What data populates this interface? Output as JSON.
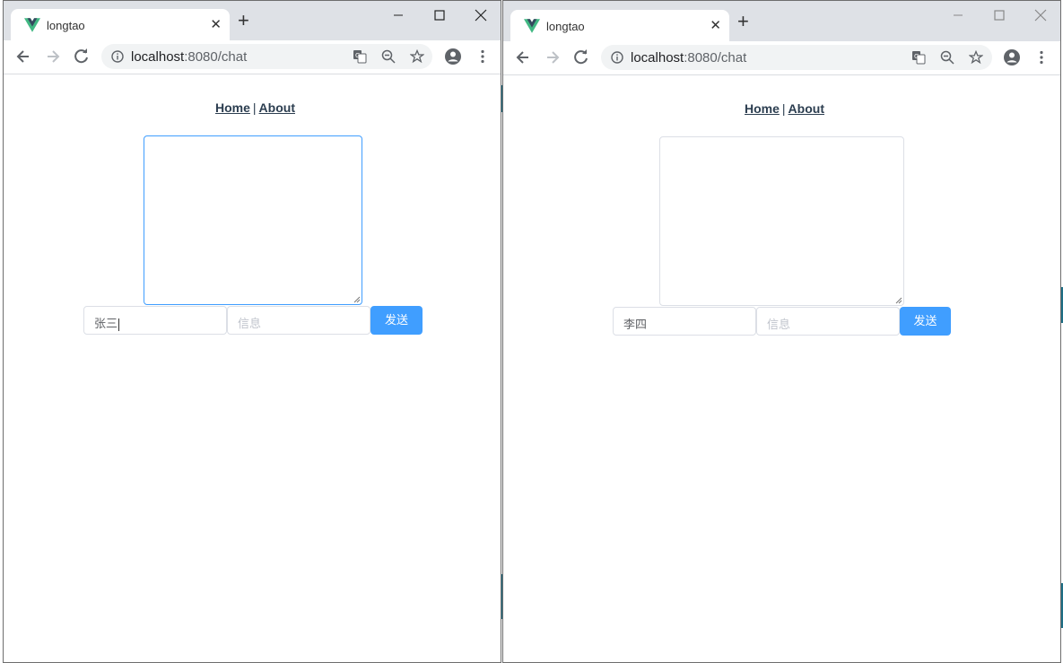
{
  "windows": [
    {
      "tab_title": "longtao",
      "url_host": "localhost",
      "url_path": ":8080/chat",
      "nav": {
        "home": "Home",
        "separator": "|",
        "about": "About"
      },
      "chat_log": "",
      "name_value": "张三",
      "message_placeholder": "信息",
      "send_label": "发送"
    },
    {
      "tab_title": "longtao",
      "url_host": "localhost",
      "url_path": ":8080/chat",
      "nav": {
        "home": "Home",
        "separator": "|",
        "about": "About"
      },
      "chat_log": "",
      "name_value": "李四",
      "message_placeholder": "信息",
      "send_label": "发送"
    }
  ],
  "colors": {
    "accent": "#409eff",
    "vue_green": "#41b883",
    "vue_dark": "#35495e",
    "link": "#2c3e50"
  },
  "icons": [
    "vue-logo-icon",
    "close-icon",
    "plus-icon",
    "minimize-icon",
    "maximize-icon",
    "back-arrow-icon",
    "forward-arrow-icon",
    "reload-icon",
    "info-icon",
    "translate-icon",
    "zoom-out-icon",
    "star-icon",
    "account-icon",
    "more-vert-icon"
  ]
}
